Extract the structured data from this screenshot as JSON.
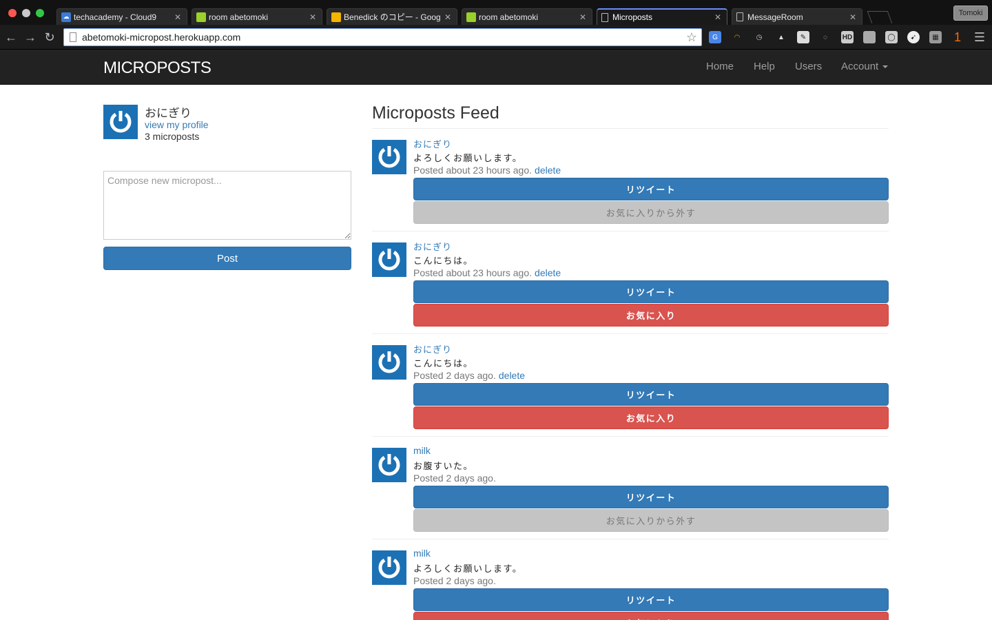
{
  "browser": {
    "tabs": [
      {
        "title": "techacademy - Cloud9",
        "favicon_color": "#3a7bd5"
      },
      {
        "title": "room abetomoki",
        "favicon_color": "#9bd02a"
      },
      {
        "title": "Benedick のコピー - Google",
        "favicon_color": "#f4b400"
      },
      {
        "title": "room abetomoki",
        "favicon_color": "#9bd02a"
      },
      {
        "title": "Microposts",
        "favicon_color": ""
      },
      {
        "title": "MessageRoom",
        "favicon_color": ""
      }
    ],
    "profile_label": "Tomoki",
    "url": "abetomoki-micropost.herokuapp.com",
    "badge_count": "1"
  },
  "navbar": {
    "brand": "MICROPOSTS",
    "links": {
      "home": "Home",
      "help": "Help",
      "users": "Users",
      "account": "Account"
    }
  },
  "sidebar": {
    "user_name": "おにぎり",
    "view_profile": "view my profile",
    "micropost_count": "3 microposts",
    "compose_placeholder": "Compose new micropost...",
    "post_button": "Post"
  },
  "feed": {
    "title": "Microposts Feed",
    "posts": [
      {
        "author": "おにぎり",
        "content": "よろしくお願いします。",
        "posted": "Posted about 23 hours ago.",
        "delete": "delete",
        "retweet": "リツイート",
        "favorite": "お気に入りから外す"
      },
      {
        "author": "おにぎり",
        "content": "こんにちは。",
        "posted": "Posted about 23 hours ago.",
        "delete": "delete",
        "retweet": "リツイート",
        "favorite": "お気に入り"
      },
      {
        "author": "おにぎり",
        "content": "こんにちは。",
        "posted": "Posted 2 days ago.",
        "delete": "delete",
        "retweet": "リツイート",
        "favorite": "お気に入り"
      },
      {
        "author": "milk",
        "content": "お腹すいた。",
        "posted": "Posted 2 days ago.",
        "delete": "",
        "retweet": "リツイート",
        "favorite": "お気に入りから外す"
      },
      {
        "author": "milk",
        "content": "よろしくお願いします。",
        "posted": "Posted 2 days ago.",
        "delete": "",
        "retweet": "リツイート",
        "favorite": "お気に入り"
      }
    ]
  },
  "colors": {
    "primary": "#337ab7",
    "danger": "#d9534f",
    "muted_button": "#c4c4c4",
    "navbar": "#222222",
    "gravatar": "#1c71b4"
  }
}
